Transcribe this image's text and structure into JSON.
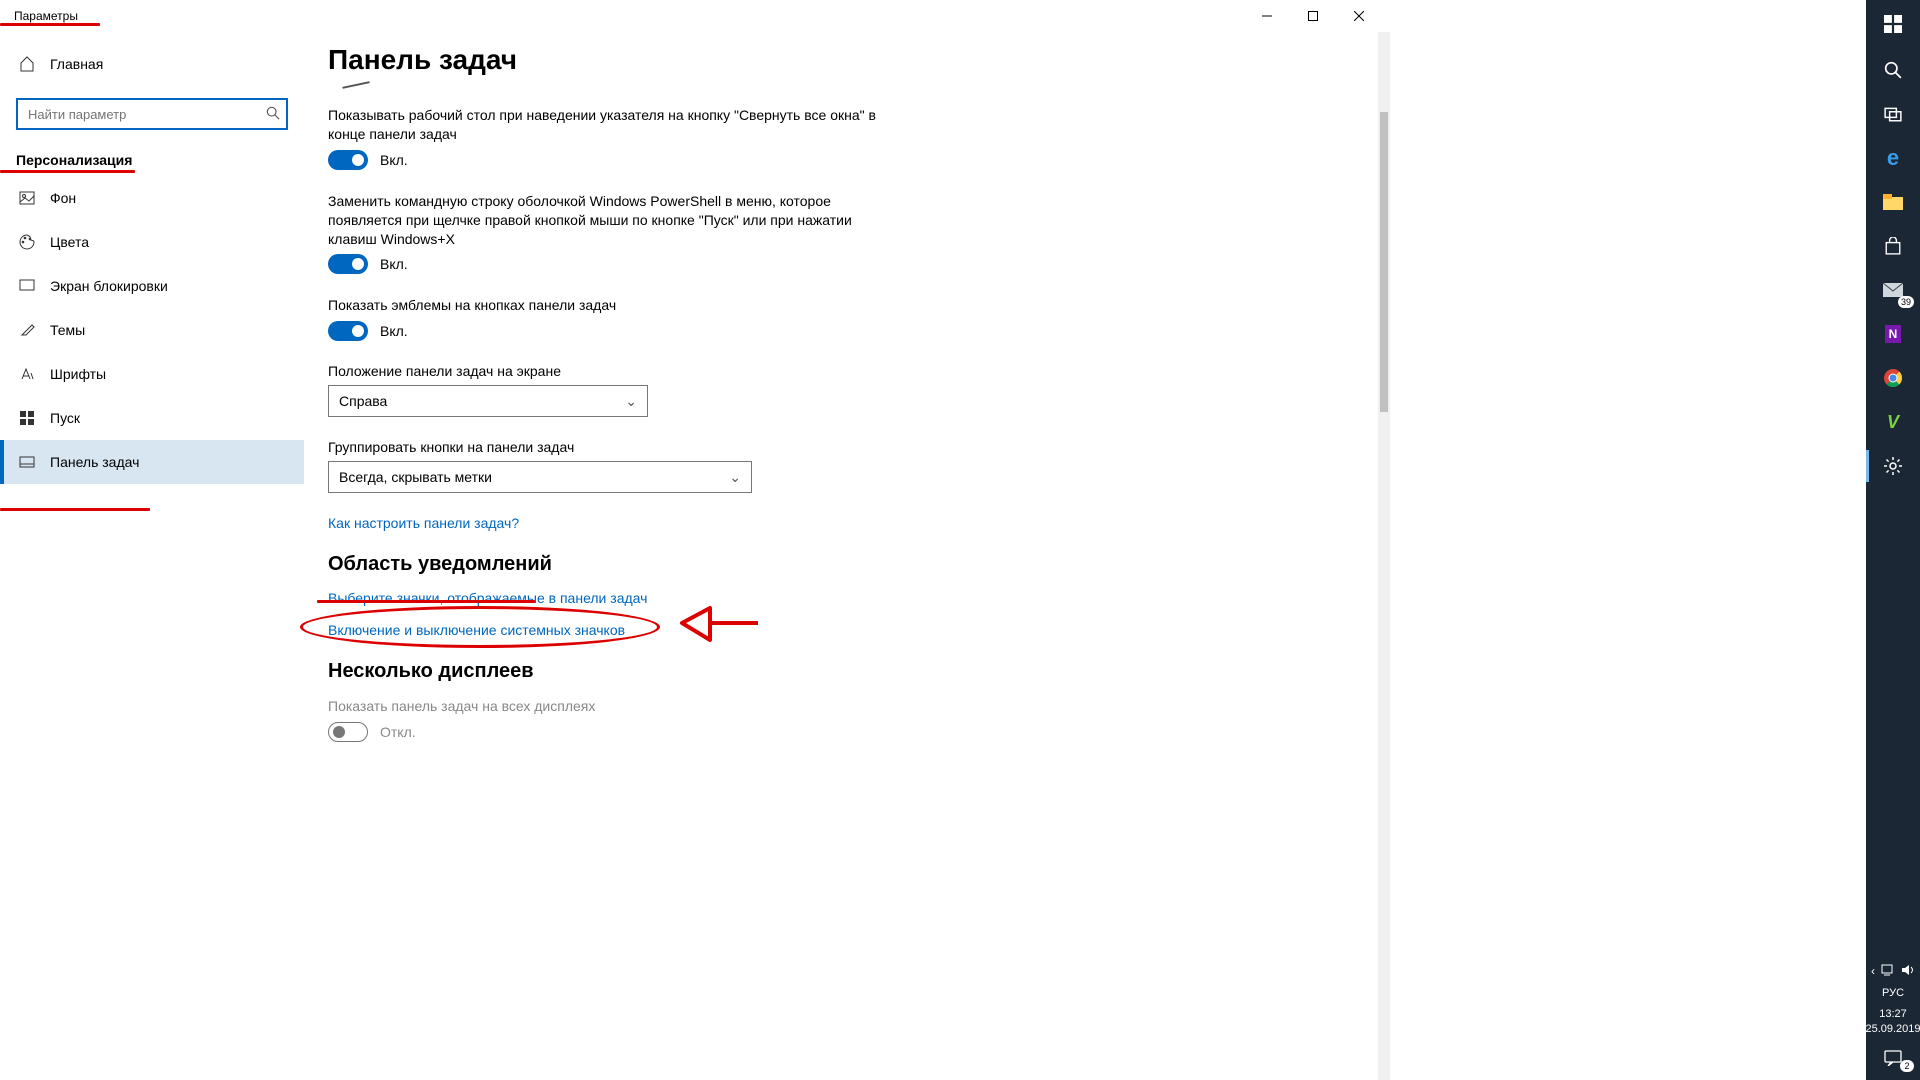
{
  "window": {
    "title": "Параметры"
  },
  "sidebar": {
    "home": "Главная",
    "search_placeholder": "Найти параметр",
    "section": "Персонализация",
    "items": [
      {
        "label": "Фон"
      },
      {
        "label": "Цвета"
      },
      {
        "label": "Экран блокировки"
      },
      {
        "label": "Темы"
      },
      {
        "label": "Шрифты"
      },
      {
        "label": "Пуск"
      },
      {
        "label": "Панель задач"
      }
    ]
  },
  "page": {
    "title": "Панель задач",
    "setting1": {
      "text": "Показывать рабочий стол при наведении указателя на кнопку \"Свернуть все окна\" в конце панели задач",
      "state": "Вкл."
    },
    "setting2": {
      "text": "Заменить командную строку оболочкой Windows PowerShell в меню, которое появляется при щелчке правой кнопкой мыши по кнопке \"Пуск\" или при нажатии клавиш Windows+X",
      "state": "Вкл."
    },
    "setting3": {
      "text": "Показать эмблемы на кнопках панели задач",
      "state": "Вкл."
    },
    "position": {
      "label": "Положение панели задач на экране",
      "value": "Справа"
    },
    "grouping": {
      "label": "Группировать кнопки на панели задач",
      "value": "Всегда, скрывать метки"
    },
    "help_link": "Как настроить панели задач?",
    "notifications_section": "Область уведомлений",
    "link_select_icons": "Выберите значки, отображаемые в панели задач",
    "link_system_icons": "Включение и выключение системных значков",
    "multi_display_section": "Несколько дисплеев",
    "multi_display_setting": {
      "text": "Показать панель задач на всех дисплеях",
      "state": "Откл."
    }
  },
  "taskbar": {
    "mail_badge": "39",
    "action_badge": "2",
    "lang": "РУС",
    "time": "13:27",
    "date": "25.09.2019"
  }
}
